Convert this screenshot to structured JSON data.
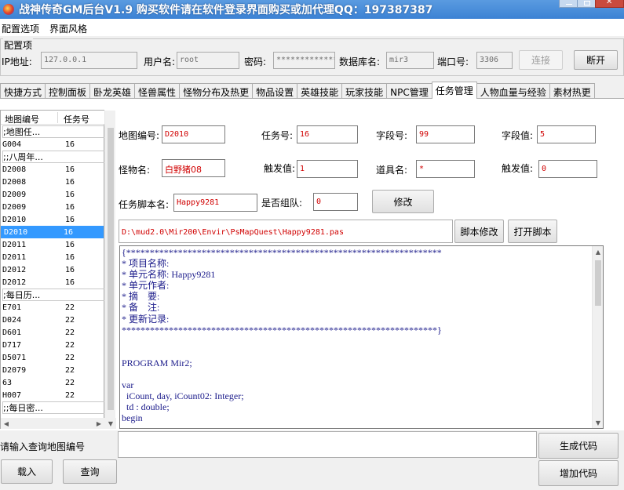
{
  "window": {
    "title": "战神传奇GM后台V1.9   购买软件请在软件登录界面购买或加代理QQ：197387387"
  },
  "menu": {
    "items": [
      "配置选项",
      "界面风格"
    ]
  },
  "config": {
    "group_label": "配置项",
    "ip_label": "IP地址:",
    "ip_value": "127.0.0.1",
    "user_label": "用户名:",
    "user_value": "root",
    "password_label": "密码:",
    "password_value": "*************",
    "db_label": "数据库名:",
    "db_value": "mir3",
    "port_label": "端口号:",
    "port_value": "3306",
    "connect_label": "连接",
    "disconnect_label": "断开"
  },
  "tabs": [
    "快捷方式",
    "控制面板",
    "卧龙英雄",
    "怪兽属性",
    "怪物分布及热更",
    "物品设置",
    "英雄技能",
    "玩家技能",
    "NPC管理",
    "任务管理",
    "人物血量与经验",
    "素材热更"
  ],
  "list": {
    "col1": "地图编号",
    "col2": "任务号",
    "rows": [
      {
        "map": ";地图任...",
        "task": ""
      },
      {
        "map": "G004",
        "task": "16"
      },
      {
        "map": ";;八周年...",
        "task": ""
      },
      {
        "map": "D2008",
        "task": "16"
      },
      {
        "map": "D2008",
        "task": "16"
      },
      {
        "map": "D2009",
        "task": "16"
      },
      {
        "map": "D2009",
        "task": "16"
      },
      {
        "map": "D2010",
        "task": "16"
      },
      {
        "map": "D2010",
        "task": "16"
      },
      {
        "map": "D2011",
        "task": "16"
      },
      {
        "map": "D2011",
        "task": "16"
      },
      {
        "map": "D2012",
        "task": "16"
      },
      {
        "map": "D2012",
        "task": "16"
      },
      {
        "map": ";每日历...",
        "task": ""
      },
      {
        "map": "E701",
        "task": "22"
      },
      {
        "map": "D024",
        "task": "22"
      },
      {
        "map": "D601",
        "task": "22"
      },
      {
        "map": "D717",
        "task": "22"
      },
      {
        "map": "D5071",
        "task": "22"
      },
      {
        "map": "D2079",
        "task": "22"
      },
      {
        "map": "63",
        "task": "22"
      },
      {
        "map": "H007",
        "task": "22"
      },
      {
        "map": ";;每日密...",
        "task": ""
      }
    ]
  },
  "form": {
    "map_label": "地图编号:",
    "map_value": "D2010",
    "task_label": "任务号:",
    "task_value": "16",
    "field_label": "字段号:",
    "field_value": "99",
    "fieldval_label": "字段值:",
    "fieldval_value": "5",
    "monster_label": "怪物名:",
    "monster_value": "白野猪08",
    "trigger_label": "触发值:",
    "trigger_value": "1",
    "item_label": "道具名:",
    "item_value": "*",
    "trigger2_label": "触发值:",
    "trigger2_value": "0",
    "script_label": "任务脚本名:",
    "script_value": "Happy9281",
    "team_label": "是否组队:",
    "team_value": "0",
    "modify_label": "修改"
  },
  "script": {
    "path": "D:\\mud2.0\\Mir200\\Envir\\PsMapQuest\\Happy9281.pas",
    "modify_label": "脚本修改",
    "open_label": "打开脚本",
    "code": "{*******************************************************************\n* 项目名称:\n* 单元名称: Happy9281\n* 单元作者:\n* 摘    要:\n* 备    注:\n* 更新记录:\n*******************************************************************}\n\n\nPROGRAM Mir2;\n\nvar\n  iCount, day, iCount02: Integer;\n  td : double;\nbegin"
  },
  "bottom": {
    "search_label": "请输入查询地图编号",
    "load_label": "载入",
    "query_label": "查询",
    "generate_label": "生成代码",
    "add_label": "增加代码"
  },
  "colors": {
    "title_bar": "#3c82d4",
    "selection": "#3399ff",
    "value_text": "#d00000",
    "code_text": "#1a1a8a"
  }
}
